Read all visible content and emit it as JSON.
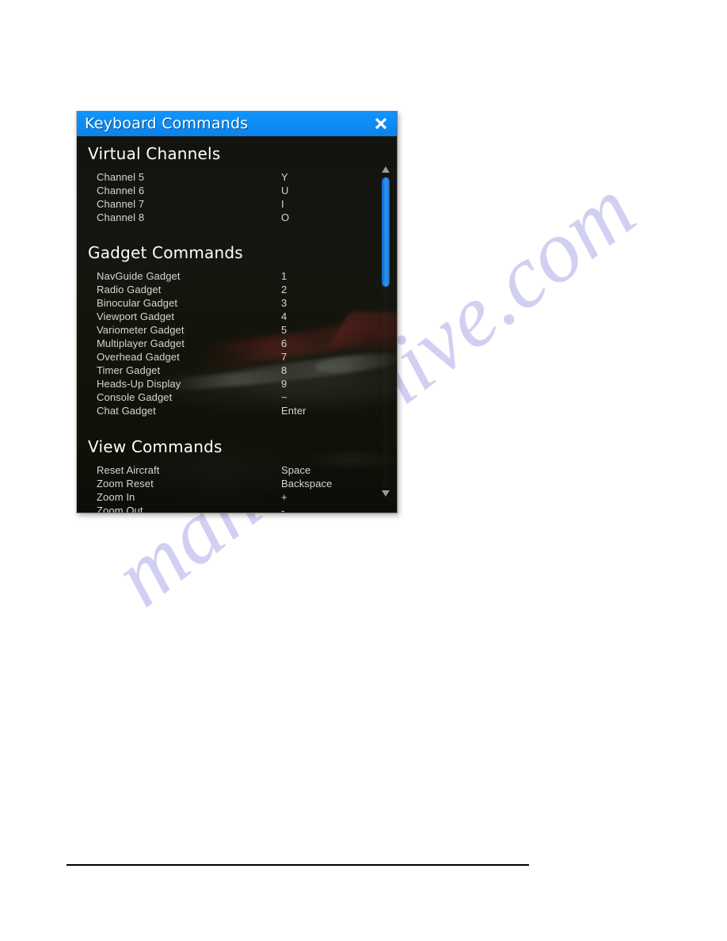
{
  "page": {
    "background_color": "#ffffff",
    "watermark_text": "manualshive.com",
    "watermark_color": "#c9c8f0"
  },
  "window": {
    "title": "Keyboard Commands",
    "titlebar_color": "#0d8cf5",
    "close_icon": "close-icon",
    "close_label": "Close"
  },
  "scrollbar": {
    "up_arrow_icon": "triangle-up-icon",
    "down_arrow_icon": "triangle-down-icon",
    "thumb_color": "#2f95f2"
  },
  "sections": [
    {
      "title": "Virtual Channels",
      "rows": [
        {
          "label": "Channel 5",
          "key": "Y"
        },
        {
          "label": "Channel 6",
          "key": "U"
        },
        {
          "label": "Channel 7",
          "key": "I"
        },
        {
          "label": "Channel 8",
          "key": "O"
        }
      ]
    },
    {
      "title": "Gadget Commands",
      "rows": [
        {
          "label": "NavGuide Gadget",
          "key": "1"
        },
        {
          "label": "Radio Gadget",
          "key": "2"
        },
        {
          "label": "Binocular Gadget",
          "key": "3"
        },
        {
          "label": "Viewport Gadget",
          "key": "4"
        },
        {
          "label": "Variometer Gadget",
          "key": "5"
        },
        {
          "label": "Multiplayer Gadget",
          "key": "6"
        },
        {
          "label": "Overhead Gadget",
          "key": "7"
        },
        {
          "label": "Timer Gadget",
          "key": "8"
        },
        {
          "label": "Heads-Up Display",
          "key": "9"
        },
        {
          "label": "Console Gadget",
          "key": "~"
        },
        {
          "label": "Chat Gadget",
          "key": "Enter"
        }
      ]
    },
    {
      "title": "View Commands",
      "rows": [
        {
          "label": "Reset Aircraft",
          "key": "Space"
        },
        {
          "label": "Zoom Reset",
          "key": "Backspace"
        },
        {
          "label": "Zoom In",
          "key": "+"
        },
        {
          "label": "Zoom Out",
          "key": "-"
        }
      ]
    }
  ]
}
